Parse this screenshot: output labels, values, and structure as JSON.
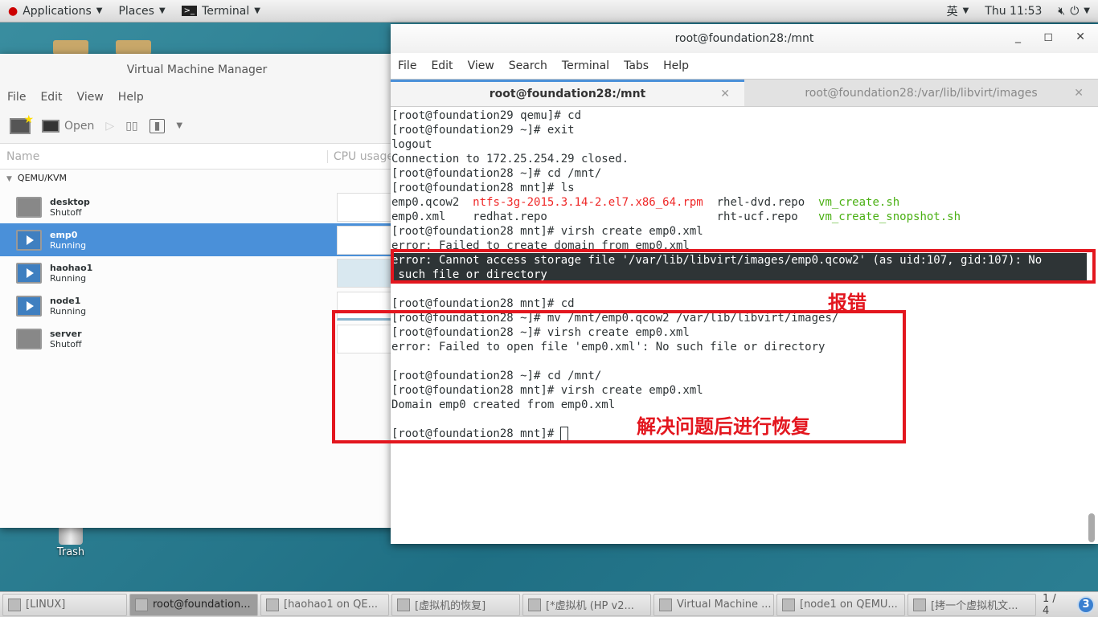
{
  "topbar": {
    "applications": "Applications",
    "places": "Places",
    "terminal": "Terminal",
    "input_method": "英",
    "clock": "Thu 11:53"
  },
  "desktop": {
    "trash": "Trash"
  },
  "vmm": {
    "title": "Virtual Machine Manager",
    "menu": [
      "File",
      "Edit",
      "View",
      "Help"
    ],
    "open": "Open",
    "col_name": "Name",
    "col_cpu": "CPU usage",
    "group": "QEMU/KVM",
    "vms": [
      {
        "name": "desktop",
        "status": "Shutoff",
        "running": false
      },
      {
        "name": "emp0",
        "status": "Running",
        "running": true,
        "selected": true
      },
      {
        "name": "haohao1",
        "status": "Running",
        "running": true
      },
      {
        "name": "node1",
        "status": "Running",
        "running": true
      },
      {
        "name": "server",
        "status": "Shutoff",
        "running": false
      }
    ]
  },
  "terminal": {
    "title": "root@foundation28:/mnt",
    "menu": [
      "File",
      "Edit",
      "View",
      "Search",
      "Terminal",
      "Tabs",
      "Help"
    ],
    "tabs": [
      {
        "label": "root@foundation28:/mnt",
        "active": true
      },
      {
        "label": "root@foundation28:/var/lib/libvirt/images",
        "active": false
      }
    ],
    "lines": [
      [
        {
          "t": "[root@foundation29 qemu]# cd"
        }
      ],
      [
        {
          "t": "[root@foundation29 ~]# exit"
        }
      ],
      [
        {
          "t": "logout"
        }
      ],
      [
        {
          "t": "Connection to 172.25.254.29 closed."
        }
      ],
      [
        {
          "t": "[root@foundation28 ~]# cd /mnt/"
        }
      ],
      [
        {
          "t": "[root@foundation28 mnt]# ls"
        }
      ],
      [
        {
          "t": "emp0.qcow2  "
        },
        {
          "t": "ntfs-3g-2015.3.14-2.el7.x86_64.rpm",
          "c": "#ef2929"
        },
        {
          "t": "  rhel-dvd.repo  "
        },
        {
          "t": "vm_create.sh",
          "c": "#4ab013"
        }
      ],
      [
        {
          "t": "emp0.xml    redhat.repo                         rht-ucf.repo   "
        },
        {
          "t": "vm_create_snopshot.sh",
          "c": "#4ab013"
        }
      ],
      [
        {
          "t": "[root@foundation28 mnt]# virsh create emp0.xml"
        }
      ],
      [
        {
          "t": "error: Failed to create domain from emp0.xml"
        }
      ],
      [
        {
          "t": "error: Cannot access storage file '/var/lib/libvirt/images/emp0.qcow2' (as uid:107, gid:107): No",
          "hl": true
        }
      ],
      [
        {
          "t": " such file or directory",
          "hl": true
        }
      ],
      [
        {
          "t": ""
        }
      ],
      [
        {
          "t": "[root@foundation28 mnt]# cd"
        }
      ],
      [
        {
          "t": "[root@foundation28 ~]# mv /mnt/emp0.qcow2 /var/lib/libvirt/images/"
        }
      ],
      [
        {
          "t": "[root@foundation28 ~]# virsh create emp0.xml"
        }
      ],
      [
        {
          "t": "error: Failed to open file 'emp0.xml': No such file or directory"
        }
      ],
      [
        {
          "t": ""
        }
      ],
      [
        {
          "t": "[root@foundation28 ~]# cd /mnt/"
        }
      ],
      [
        {
          "t": "[root@foundation28 mnt]# virsh create emp0.xml"
        }
      ],
      [
        {
          "t": "Domain emp0 created from emp0.xml"
        }
      ],
      [
        {
          "t": ""
        }
      ],
      [
        {
          "t": "[root@foundation28 mnt]# "
        },
        {
          "t": " ",
          "cursor": true
        }
      ]
    ]
  },
  "annotations": {
    "error": "报错",
    "recovery": "解决问题后进行恢复",
    "color": "#e3161e"
  },
  "taskbar": {
    "items": [
      {
        "label": "[LINUX]"
      },
      {
        "label": "root@foundation...",
        "active": true
      },
      {
        "label": "[haohao1 on QE..."
      },
      {
        "label": "[虚拟机的恢复]"
      },
      {
        "label": "[*虚拟机 (HP v2..."
      },
      {
        "label": "Virtual Machine ..."
      },
      {
        "label": "[node1 on QEMU..."
      },
      {
        "label": "[拷一个虚拟机文..."
      }
    ],
    "workspace": "1 / 4",
    "notifications": "3"
  }
}
